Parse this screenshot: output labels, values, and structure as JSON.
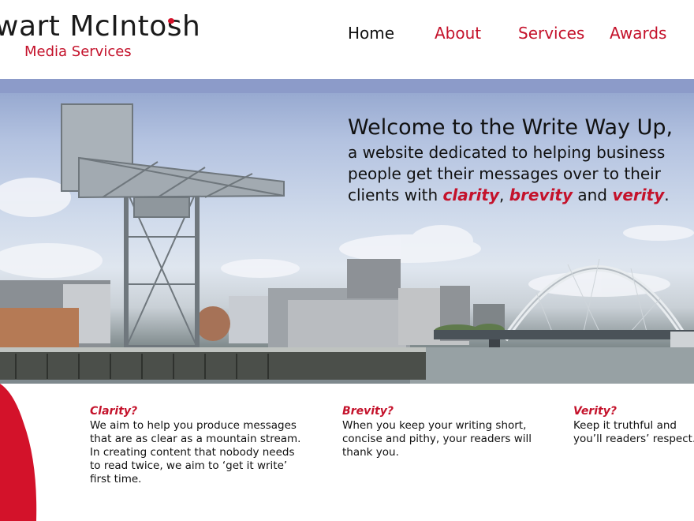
{
  "brand": {
    "name": "wart McIntosh",
    "tagline": "Media Services",
    "accent_color": "#c4122b"
  },
  "nav": {
    "items": [
      {
        "label": "Home",
        "active": true
      },
      {
        "label": "About"
      },
      {
        "label": "Services"
      },
      {
        "label": "Awards"
      }
    ]
  },
  "hero": {
    "title": "Welcome to the Write Way Up,",
    "body_line1": "a website dedicated to helping business",
    "body_line2": "people get their messages over to their",
    "body_line3_prefix": "clients with ",
    "hl1": "clarity",
    "sep1": ", ",
    "hl2": "brevity",
    "sep2": " and ",
    "hl3": "verity",
    "end": "."
  },
  "features": [
    {
      "title": "Clarity?",
      "body": "We aim to help you produce messages that are as clear as a mountain stream. In creating content that nobody needs to read twice, we aim to ‘get it write’ first time."
    },
    {
      "title": "Brevity?",
      "body": "When you keep your writing short, concise and pithy, your readers will thank you."
    },
    {
      "title": "Verity?",
      "body": "Keep it truthful and you’ll readers’ respect."
    }
  ]
}
